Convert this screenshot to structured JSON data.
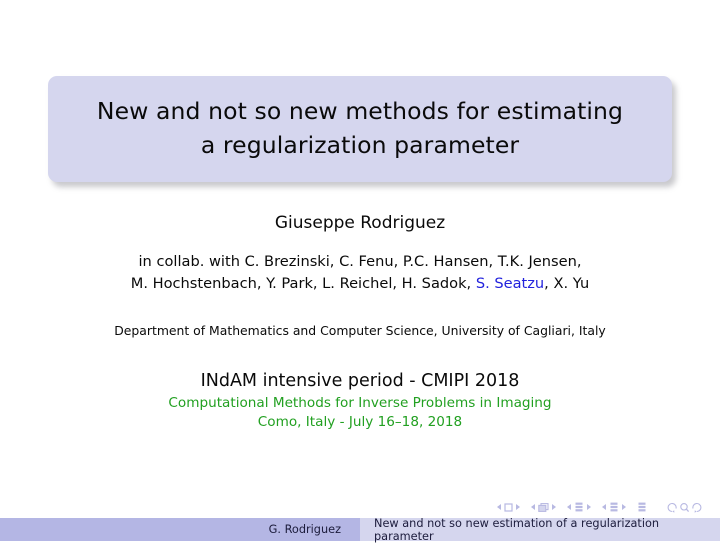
{
  "slide": {
    "title": {
      "line1": "New and not so new methods for estimating",
      "line2": "a regularization parameter"
    },
    "author": {
      "name": "Giuseppe Rodriguez",
      "collaboration_line1": "in collab. with C. Brezinski, C. Fenu, P.C. Hansen, T.K. Jensen,",
      "collaboration_line2_before": "M. Hochstenbach, Y. Park, L. Reichel, H. Sadok, ",
      "collaboration_highlight": "S. Seatzu",
      "collaboration_line2_after": ", X. Yu"
    },
    "institute": {
      "line": "Department of Mathematics and Computer Science, University of Cagliari, Italy"
    },
    "event": {
      "title": "INdAM intensive period - CMIPI 2018",
      "subtitle": "Computational Methods for Inverse Problems in Imaging",
      "location_date": "Como, Italy - July 16–18, 2018"
    },
    "footer": {
      "author_short": "G. Rodriguez",
      "title_short": "New and not so new estimation of a regularization parameter"
    },
    "navigation": {
      "slide_icon": "slide-navigation-icon",
      "frame_icon": "frame-navigation-icon",
      "subsection_icon": "subsection-navigation-icon",
      "section_icon": "section-navigation-icon",
      "doc_icon": "document-navigation-icon",
      "back_icon": "back-navigation-icon",
      "search_icon": "search-navigation-icon",
      "forward_icon": "forward-navigation-icon"
    },
    "colors": {
      "title_block_bg": "#d5d6ee",
      "footer_left_bg": "#b4b6e4",
      "footer_right_bg": "#d5d6ee",
      "link_blue": "#2222dd",
      "event_green": "#22a021",
      "nav_symbol": "#b8b9e2",
      "text_black": "#0a0a0a"
    }
  }
}
